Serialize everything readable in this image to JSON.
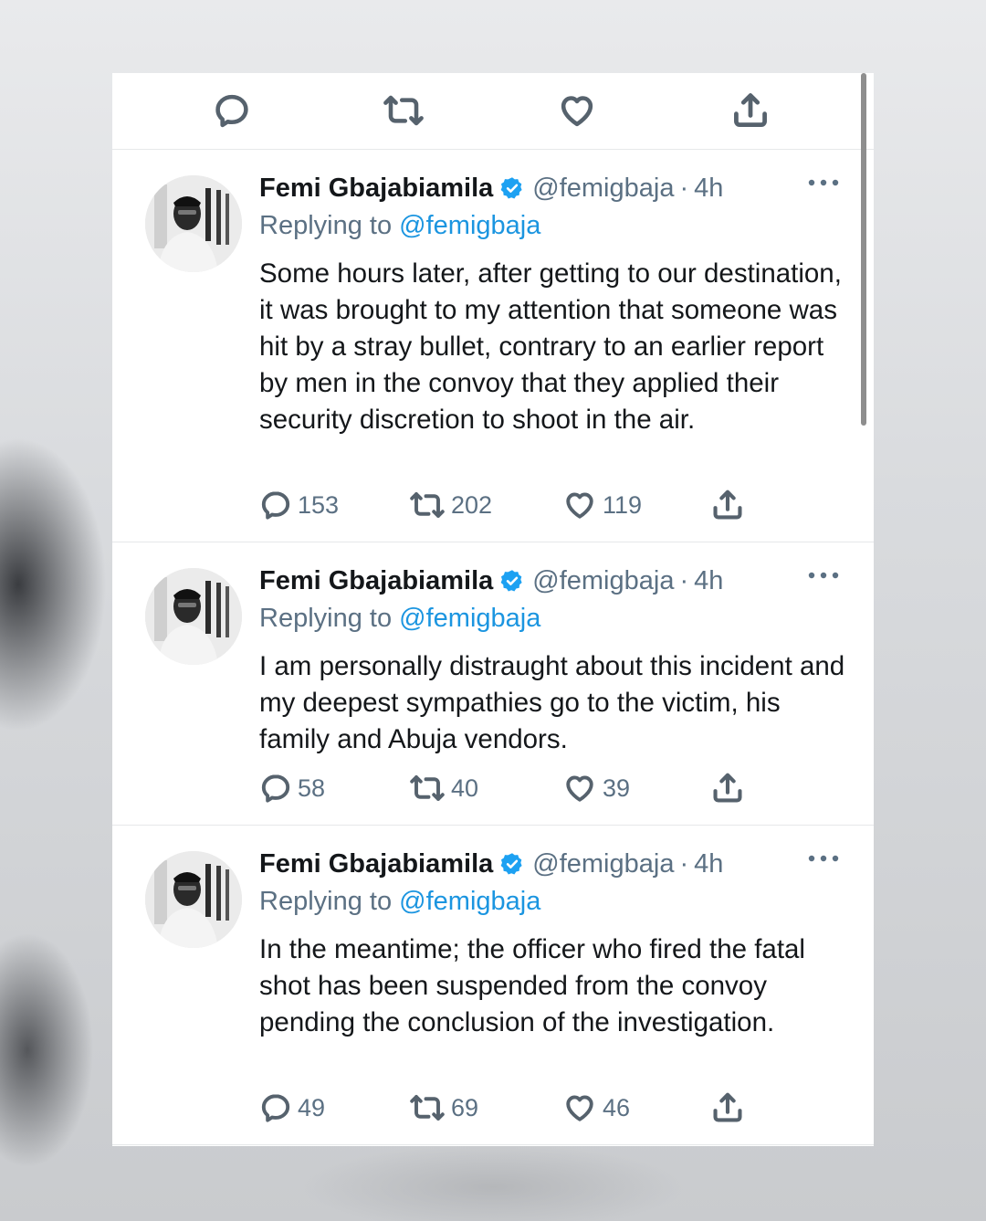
{
  "colors": {
    "accent": "#1b95e0",
    "verified": "#1da1f2",
    "secondary_text": "#5b7083",
    "primary_text": "#14171a",
    "icon": "#56626d"
  },
  "top_actions": [
    {
      "icon": "reply-icon"
    },
    {
      "icon": "retweet-icon"
    },
    {
      "icon": "like-icon"
    },
    {
      "icon": "share-icon"
    }
  ],
  "tweets": [
    {
      "name": "Femi Gbajabiamila",
      "handle": "@femigbaja",
      "dot": "·",
      "time": "4h",
      "replying_prefix": "Replying to ",
      "replying_to": "@femigbaja",
      "text": "Some hours later, after getting to our destination, it was brought to my attention that someone was hit by a stray bullet, contrary to an earlier report by men in the convoy that they applied their security discretion to shoot in the air.",
      "replies": "153",
      "retweets": "202",
      "likes": "119"
    },
    {
      "name": "Femi Gbajabiamila",
      "handle": "@femigbaja",
      "dot": "·",
      "time": "4h",
      "replying_prefix": "Replying to ",
      "replying_to": "@femigbaja",
      "text": "I am personally distraught about this incident and my deepest sympathies go to the victim, his family and Abuja vendors.",
      "replies": "58",
      "retweets": "40",
      "likes": "39"
    },
    {
      "name": "Femi Gbajabiamila",
      "handle": "@femigbaja",
      "dot": "·",
      "time": "4h",
      "replying_prefix": "Replying to ",
      "replying_to": "@femigbaja",
      "text": "In the meantime; the officer who fired the fatal shot has been suspended from the convoy pending the conclusion of the investigation.",
      "replies": "49",
      "retweets": "69",
      "likes": "46"
    }
  ]
}
